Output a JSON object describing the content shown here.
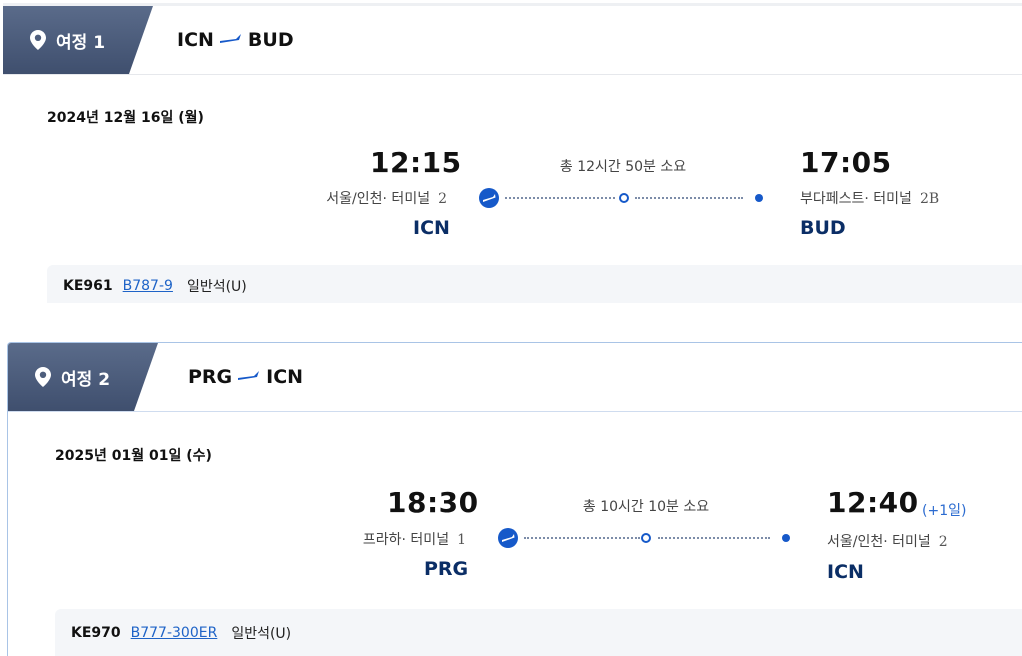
{
  "legs": [
    {
      "tab_label": "여정 1",
      "route_from": "ICN",
      "route_to": "BUD",
      "date": "2024년 12월 16일 (월)",
      "departure": {
        "time": "12:15",
        "city": "서울/인천· 터미널",
        "terminal": "2",
        "code": "ICN"
      },
      "duration": "총 12시간 50분 소요",
      "arrival": {
        "time": "17:05",
        "city": "부다페스트· 터미널",
        "terminal": "2B",
        "code": "BUD",
        "day_offset": ""
      },
      "flight_number": "KE961",
      "aircraft": "B787-9",
      "cabin": "일반석(U)"
    },
    {
      "tab_label": "여정 2",
      "route_from": "PRG",
      "route_to": "ICN",
      "date": "2025년 01월 01일 (수)",
      "departure": {
        "time": "18:30",
        "city": "프라하· 터미널",
        "terminal": "1",
        "code": "PRG"
      },
      "duration": "총 10시간 10분 소요",
      "arrival": {
        "time": "12:40",
        "city": "서울/인천· 터미널",
        "terminal": "2",
        "code": "ICN",
        "day_offset": "(+1일)"
      },
      "flight_number": "KE970",
      "aircraft": "B777-300ER",
      "cabin": "일반석(U)"
    }
  ],
  "icons": {
    "tab": "location-pin-icon",
    "route": "plane-icon",
    "departure": "takeoff-icon"
  },
  "colors": {
    "tab": "#4a5a7a",
    "accent": "#1659c9",
    "code": "#0b2e66",
    "link": "#1e63c7",
    "highlight_border": "#a9c4e6"
  }
}
